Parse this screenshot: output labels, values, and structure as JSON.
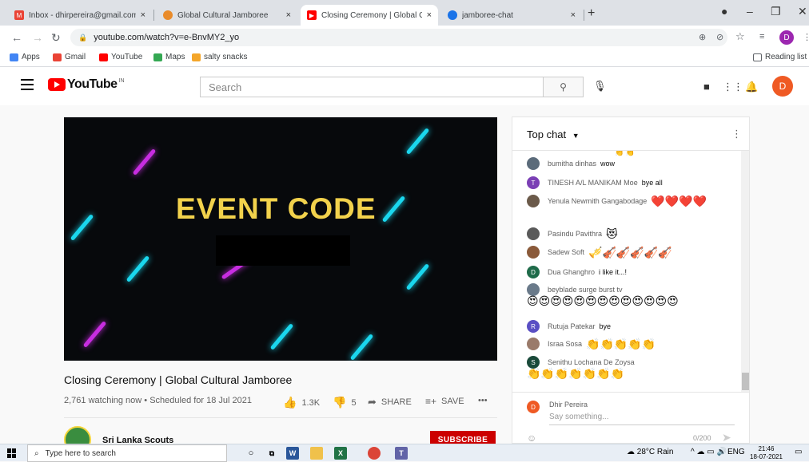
{
  "browser": {
    "tabs": [
      {
        "title": "Inbox - dhirpereira@gmail.com -",
        "close": "×"
      },
      {
        "title": "Global Cultural Jamboree",
        "close": "×"
      },
      {
        "title": "Closing Ceremony | Global Cultu",
        "close": "×"
      },
      {
        "title": "jamboree-chat",
        "close": "×"
      }
    ],
    "new_tab": "+",
    "url": "youtube.com/watch?v=e-BnvMY2_yo",
    "profile_initial": "D",
    "bookmarks": [
      {
        "label": "Apps",
        "color": "#4285f4"
      },
      {
        "label": "Gmail",
        "color": "#ea4335"
      },
      {
        "label": "YouTube",
        "color": "#ff0000"
      },
      {
        "label": "Maps",
        "color": "#34a853"
      },
      {
        "label": "salty snacks",
        "color": "#f4a62a"
      }
    ],
    "reading_list": "Reading list"
  },
  "youtube": {
    "logo_text": "YouTube",
    "country_code": "IN",
    "search_placeholder": "Search",
    "avatar_initial": "D"
  },
  "video": {
    "overlay_text": "EVENT CODE",
    "title": "Closing Ceremony | Global Cultural Jamboree",
    "meta": "2,761 watching now • Scheduled for 18 Jul 2021",
    "likes": "1.3K",
    "dislikes": "5",
    "share_label": "SHARE",
    "save_label": "SAVE",
    "more": "•••",
    "channel_name": "Sri Lanka Scouts",
    "subscribe_label": "SUBSCRIBE"
  },
  "chat": {
    "header": "Top chat",
    "messages": [
      {
        "author": "bumitha dinhas",
        "text": "wow",
        "emojis": "",
        "avatar_color": "#5b6b7a",
        "initial": ""
      },
      {
        "author": "TINESH A/L MANIKAM Moe",
        "text": "bye all",
        "emojis": "",
        "avatar_color": "#7b3fb5",
        "initial": "T"
      },
      {
        "author": "Yenula Newmith Gangabodage",
        "text": "",
        "emojis": "❤️❤️❤️❤️",
        "avatar_color": "#6b5a4a",
        "initial": ""
      },
      {
        "author": "Pasindu Pavithra",
        "text": "",
        "emojis": "😻",
        "avatar_color": "#5a5a5a",
        "initial": ""
      },
      {
        "author": "Sadew Soft",
        "text": "",
        "emojis": "🎺🎻🎻🎻🎻🎻",
        "avatar_color": "#8a5a3a",
        "initial": ""
      },
      {
        "author": "Dua Ghanghro",
        "text": "i like it...!",
        "emojis": "",
        "avatar_color": "#1f6b4a",
        "initial": "D"
      },
      {
        "author": "beyblade surge burst tv",
        "text": "",
        "emojis": "😍😍😍😍😍😍😍😍😍😍😍😍😍",
        "avatar_color": "#6a7a8a",
        "initial": ""
      },
      {
        "author": "Rutuja Patekar",
        "text": "bye",
        "emojis": "",
        "avatar_color": "#5a4fc4",
        "initial": "R"
      },
      {
        "author": "Israa Sosa",
        "text": "",
        "emojis": "👏👏👏👏👏",
        "avatar_color": "#9a7a6a",
        "initial": ""
      },
      {
        "author": "Senithu Lochana De Zoysa",
        "text": "",
        "emojis": "👏👏👏👏👏👏👏",
        "avatar_color": "#1a4a3a",
        "initial": "S"
      }
    ],
    "me_name": "Dhir Pereira",
    "me_initial": "D",
    "input_placeholder": "Say something...",
    "counter": "0/200"
  },
  "taskbar": {
    "search_placeholder": "Type here to search",
    "weather": "28°C Rain",
    "lang": "ENG",
    "time": "21:46",
    "date": "18-07-2021"
  }
}
